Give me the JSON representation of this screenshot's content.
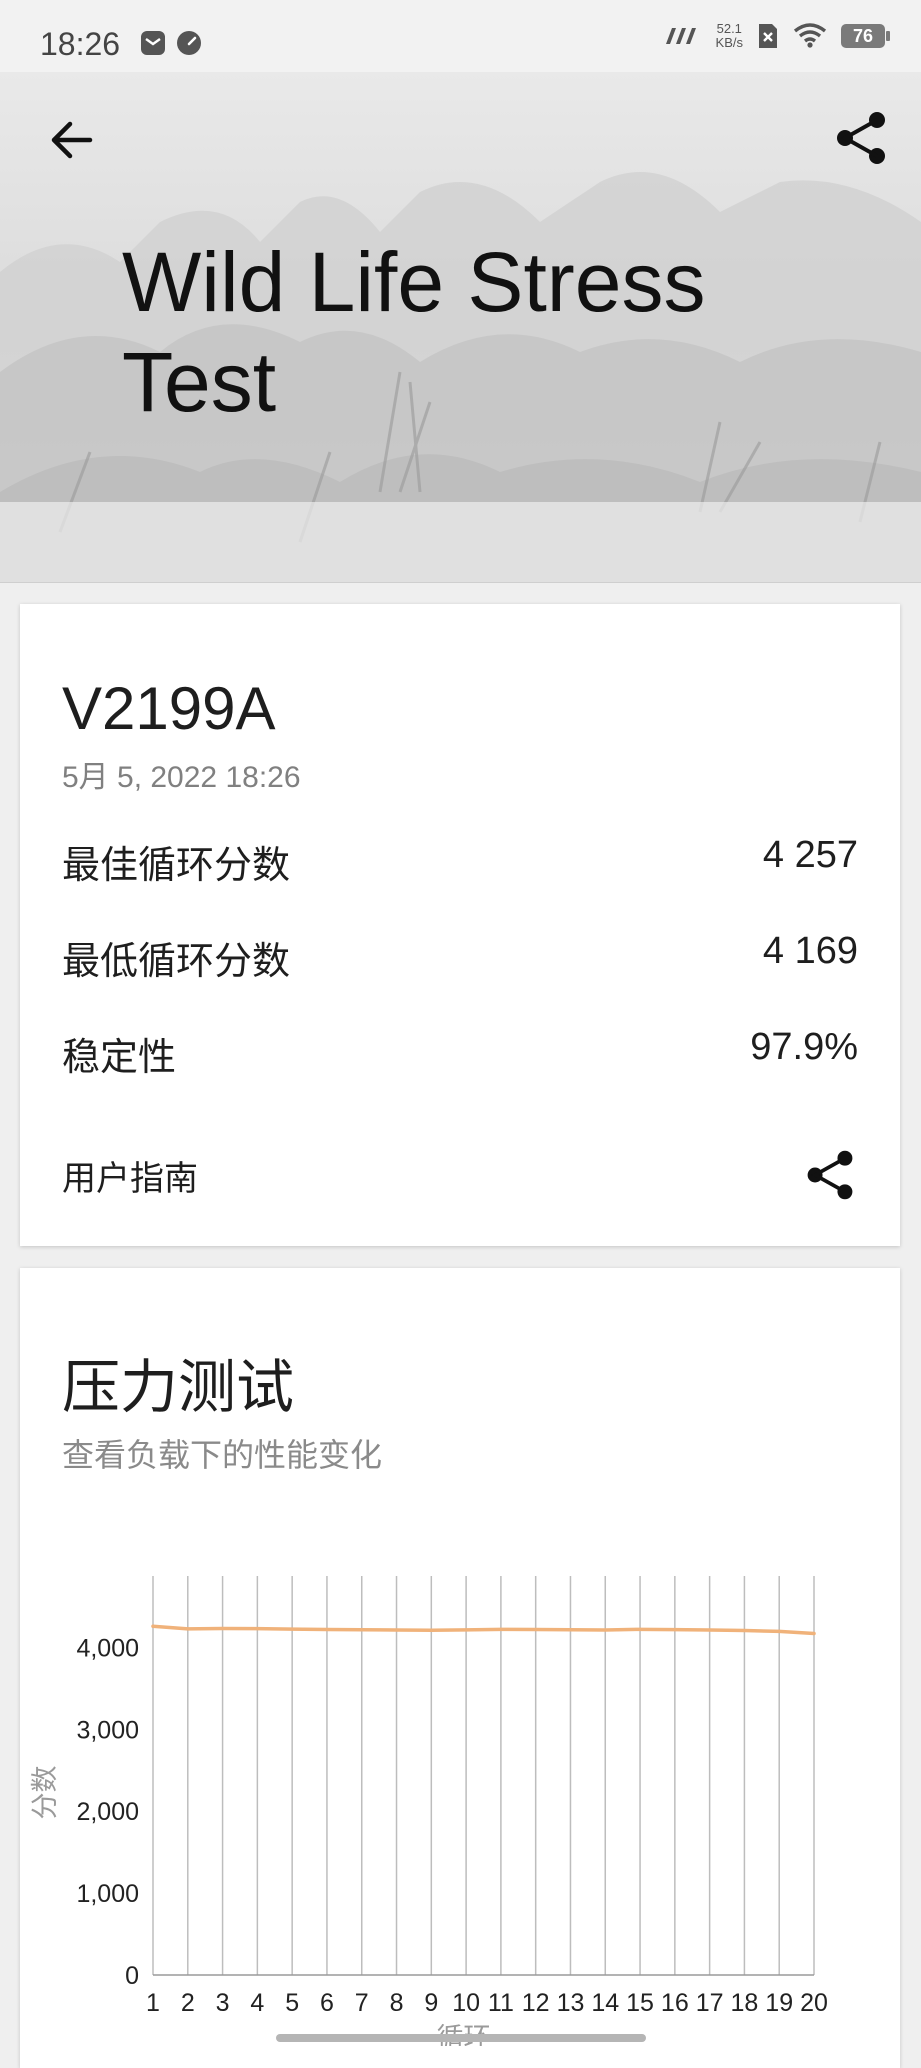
{
  "status_bar": {
    "time": "18:26",
    "net_speed_value": "52.1",
    "net_speed_unit": "KB/s",
    "battery": "76"
  },
  "header": {
    "title": "Wild Life Stress Test"
  },
  "summary": {
    "device": "V2199A",
    "date": "5月 5, 2022 18:26",
    "rows": [
      {
        "label": "最佳循环分数",
        "value": "4 257"
      },
      {
        "label": "最低循环分数",
        "value": "4 169"
      },
      {
        "label": "稳定性",
        "value": "97.9%"
      }
    ],
    "guide_label": "用户指南"
  },
  "stress": {
    "title": "压力测试",
    "subtitle": "查看负载下的性能变化"
  },
  "chart_data": {
    "type": "line",
    "xlabel": "循环",
    "ylabel": "分数",
    "x": [
      1,
      2,
      3,
      4,
      5,
      6,
      7,
      8,
      9,
      10,
      11,
      12,
      13,
      14,
      15,
      16,
      17,
      18,
      19,
      20
    ],
    "series": [
      {
        "values": [
          4257,
          4225,
          4230,
          4228,
          4222,
          4218,
          4215,
          4212,
          4208,
          4213,
          4220,
          4218,
          4215,
          4212,
          4220,
          4216,
          4212,
          4205,
          4195,
          4169
        ]
      }
    ],
    "ylim": [
      0,
      4700
    ],
    "yticks": [
      0,
      1000,
      2000,
      3000,
      4000
    ],
    "ytick_labels": [
      "0",
      "1,000",
      "2,000",
      "3,000",
      "4,000"
    ],
    "grid": "vertical",
    "line_color": "#f0b27a"
  }
}
